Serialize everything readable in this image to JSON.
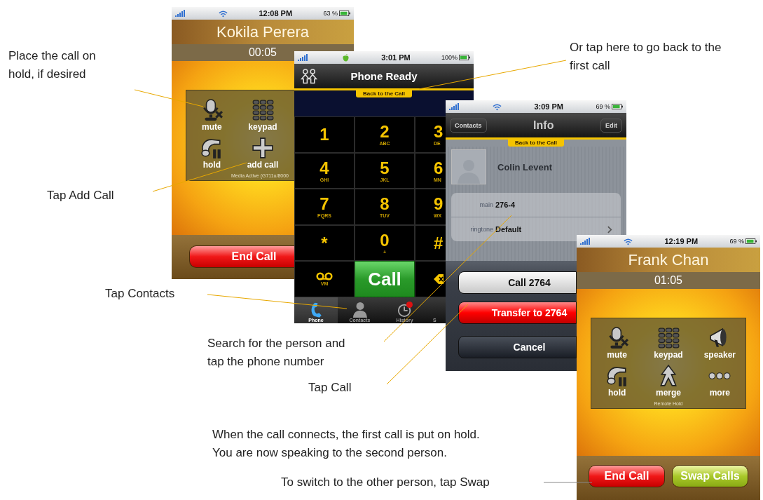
{
  "annotations": [
    {
      "text": "Place the call on\nhold, if desired"
    },
    {
      "text": "Or tap here to go back to the\nfirst call"
    },
    {
      "text": "Tap Add Call"
    },
    {
      "text": "Tap Contacts"
    },
    {
      "text": "Search for the person and\ntap the phone number"
    },
    {
      "text": "Tap Call"
    },
    {
      "text": "When the call connects, the first call is put on hold.\nYou are now speaking to the second person."
    },
    {
      "text": "To switch to the other person, tap Swap"
    }
  ],
  "screens": [
    {
      "kind": "in_call",
      "status_bar": {
        "time": "12:08 PM",
        "battery": "63 %"
      },
      "caller": "Kokila Perera",
      "duration": "00:05",
      "control_rows": [
        {
          "controls": [
            {
              "kind": "mute",
              "label": "mute"
            },
            {
              "kind": "keypad",
              "label": "keypad"
            }
          ]
        },
        {
          "controls": [
            {
              "kind": "hold",
              "label": "hold"
            },
            {
              "kind": "add",
              "label": "add call"
            }
          ]
        }
      ],
      "note": "Media Active (G711u/8000",
      "buttons": [
        {
          "kind": "end",
          "label": "End Call"
        }
      ]
    },
    {
      "kind": "dialer",
      "status_bar": {
        "time": "3:01 PM",
        "battery": "100%"
      },
      "title": "Phone Ready",
      "banner": "Back to the Call",
      "key_rows": [
        {
          "keys": [
            {
              "kind": "digit",
              "digit": "1"
            },
            {
              "kind": "digit",
              "digit": "2",
              "letters": "ABC"
            },
            {
              "kind": "digit",
              "digit": "3",
              "letters": "DE"
            }
          ]
        },
        {
          "keys": [
            {
              "kind": "digit",
              "digit": "4",
              "letters": "GHI"
            },
            {
              "kind": "digit",
              "digit": "5",
              "letters": "JKL"
            },
            {
              "kind": "digit",
              "digit": "6",
              "letters": "MN"
            }
          ]
        },
        {
          "keys": [
            {
              "kind": "digit",
              "digit": "7",
              "letters": "PQRS"
            },
            {
              "kind": "digit",
              "digit": "8",
              "letters": "TUV"
            },
            {
              "kind": "digit",
              "digit": "9",
              "letters": "WX"
            }
          ]
        },
        {
          "keys": [
            {
              "kind": "digit",
              "digit": "*"
            },
            {
              "kind": "digit",
              "digit": "0",
              "letters": "+"
            },
            {
              "kind": "digit",
              "digit": "#"
            }
          ]
        },
        {
          "keys": [
            {
              "kind": "voicemail",
              "label": "VM"
            },
            {
              "kind": "call",
              "label": "Call"
            },
            {
              "kind": "delete"
            }
          ]
        }
      ],
      "tabs": [
        {
          "kind": "phone",
          "label": "Phone",
          "selected": true
        },
        {
          "kind": "contacts",
          "label": "Contacts",
          "selected": false
        },
        {
          "kind": "history",
          "label": "History",
          "selected": false
        },
        {
          "label": "S",
          "selected": false
        }
      ]
    },
    {
      "kind": "contact_info",
      "status_bar": {
        "time": "3:09 PM",
        "battery": "69 %"
      },
      "back_button": "Contacts",
      "title": "Info",
      "edit_button": "Edit",
      "banner": "Back to the Call",
      "name": "Colin Levent",
      "fields": [
        {
          "label": "main",
          "value": "276-4",
          "disclosure": false
        },
        {
          "label": "ringtone",
          "value": "Default",
          "disclosure": true
        }
      ],
      "actions": [
        {
          "kind": "default",
          "label": "Call 2764"
        },
        {
          "kind": "destructive",
          "label": "Transfer to 2764"
        },
        {
          "kind": "cancel",
          "label": "Cancel"
        }
      ]
    },
    {
      "kind": "in_call",
      "status_bar": {
        "time": "12:19 PM",
        "battery": "69 %"
      },
      "caller": "Frank Chan",
      "duration": "01:05",
      "control_rows": [
        {
          "controls": [
            {
              "kind": "mute",
              "label": "mute"
            },
            {
              "kind": "keypad",
              "label": "keypad"
            },
            {
              "kind": "speaker",
              "label": "speaker"
            }
          ]
        },
        {
          "controls": [
            {
              "kind": "hold",
              "label": "hold"
            },
            {
              "kind": "merge",
              "label": "merge"
            },
            {
              "kind": "more",
              "label": "more"
            }
          ]
        }
      ],
      "note": "Remote Hold",
      "buttons": [
        {
          "kind": "end",
          "label": "End Call"
        },
        {
          "kind": "swap",
          "label": "Swap Calls"
        }
      ]
    }
  ]
}
